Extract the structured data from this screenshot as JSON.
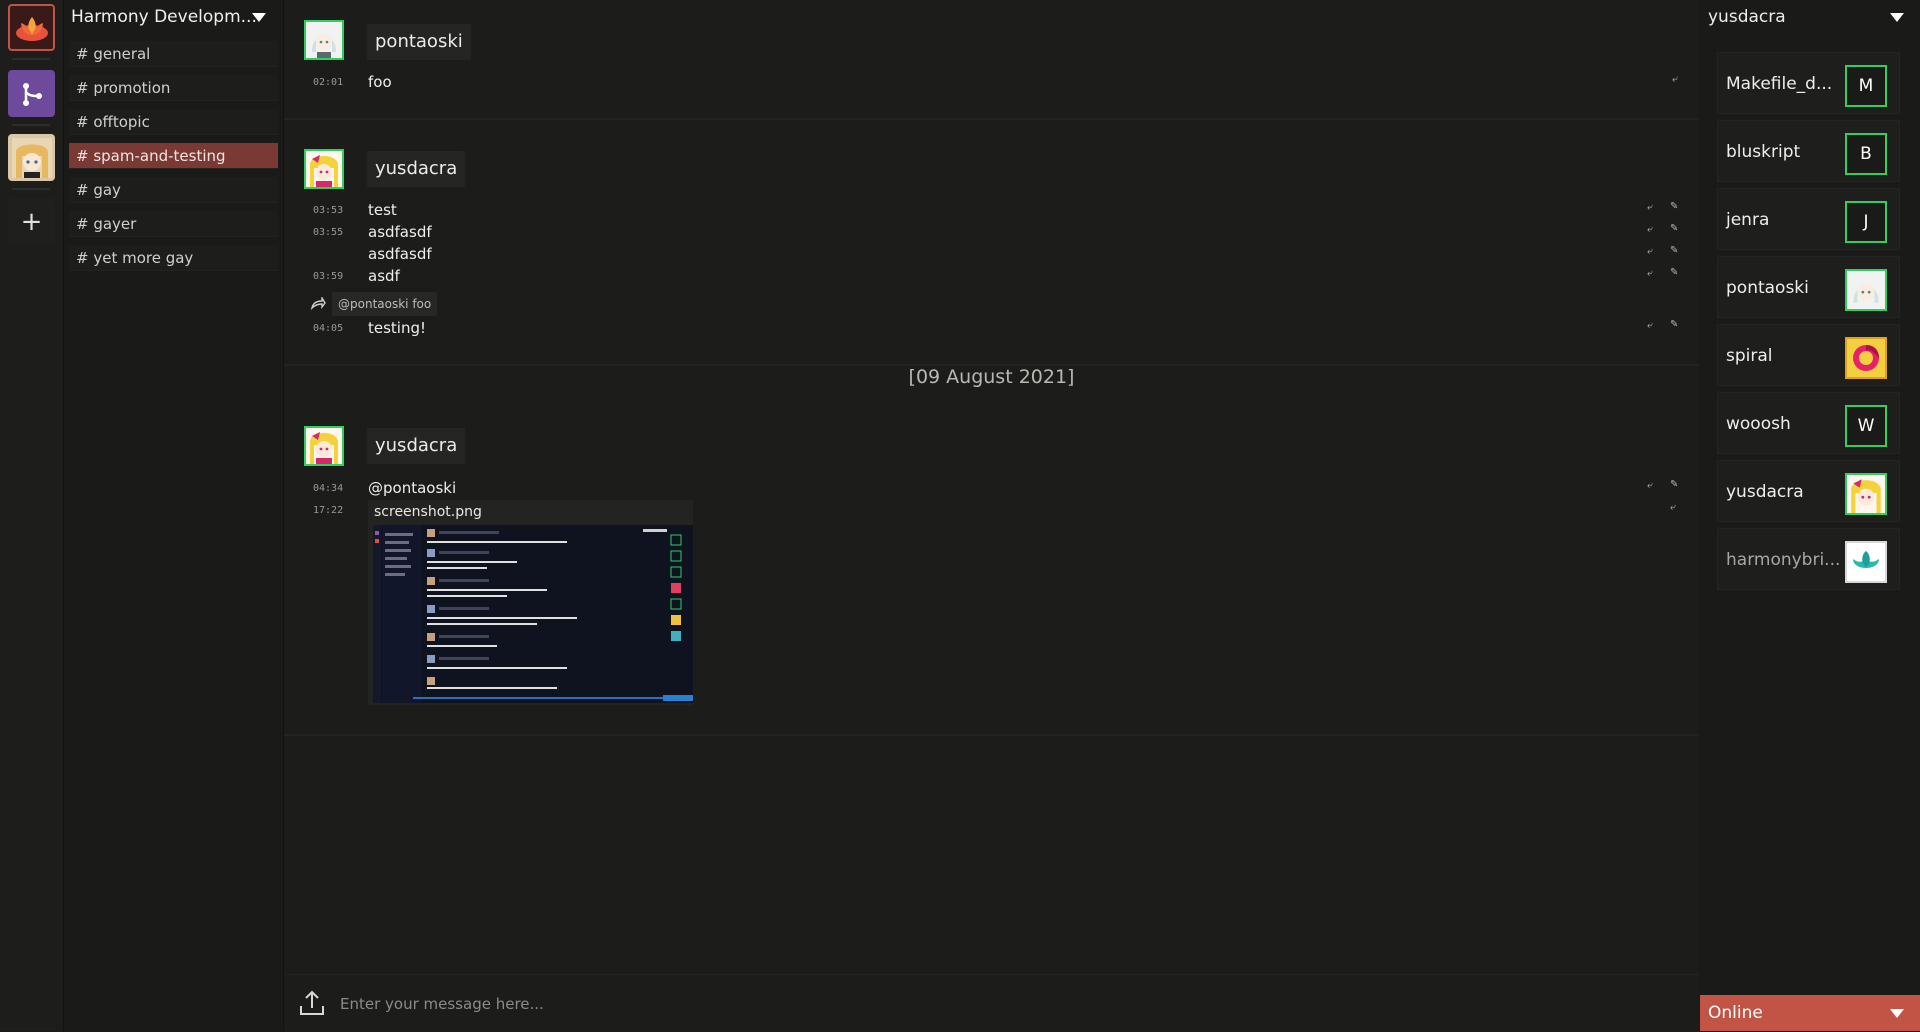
{
  "guild_bar": {
    "guilds": [
      {
        "name": "lotus-guild-icon"
      },
      {
        "name": "harmony-dev-guild-icon"
      },
      {
        "name": "anime-guild-icon"
      }
    ],
    "add_label": "+"
  },
  "guild": {
    "name": "Harmony Developm...",
    "channels": [
      {
        "label": "# general",
        "active": false
      },
      {
        "label": "# promotion",
        "active": false
      },
      {
        "label": "# offtopic",
        "active": false
      },
      {
        "label": "# spam-and-testing",
        "active": true
      },
      {
        "label": "# gay",
        "active": false
      },
      {
        "label": "# gayer",
        "active": false
      },
      {
        "label": "# yet more gay",
        "active": false
      }
    ]
  },
  "chat": {
    "groups": [
      {
        "author": "pontaoski",
        "messages": [
          {
            "time": "02:01",
            "text": "foo"
          }
        ]
      },
      {
        "author": "yusdacra",
        "messages": [
          {
            "time": "03:53",
            "text": "test"
          },
          {
            "time": "03:55",
            "text": "asdfasdf"
          },
          {
            "time": "",
            "text": "asdfasdf"
          },
          {
            "time": "03:59",
            "text": "asdf"
          },
          {
            "time": "04:05",
            "text": "testing!"
          }
        ],
        "reply": "@pontaoski foo"
      },
      {
        "author": "yusdacra",
        "messages": [
          {
            "time": "04:34",
            "text": "@pontaoski"
          },
          {
            "time": "17:22",
            "text": ""
          }
        ],
        "attachment": {
          "filename": "screenshot.png"
        }
      }
    ],
    "date_separator": "[09 August 2021]",
    "composer": {
      "placeholder": "Enter your message here..."
    }
  },
  "members": {
    "current_user": "yusdacra",
    "list": [
      {
        "name": "Makefile_d...",
        "initial": "M",
        "online": true
      },
      {
        "name": "bluskript",
        "initial": "B",
        "online": true
      },
      {
        "name": "jenra",
        "initial": "J",
        "online": true
      },
      {
        "name": "pontaoski",
        "initial": "",
        "online": true
      },
      {
        "name": "spiral",
        "initial": "",
        "online": true
      },
      {
        "name": "wooosh",
        "initial": "W",
        "online": true
      },
      {
        "name": "yusdacra",
        "initial": "",
        "online": true
      },
      {
        "name": "harmonybri...",
        "initial": "",
        "online": false
      }
    ],
    "status": "Online"
  },
  "colors": {
    "accent": "#c25446",
    "active_channel": "#7a3a33",
    "online_border": "#2fd060",
    "away_border": "#e0a020",
    "offline_border": "#d8d8d8"
  }
}
